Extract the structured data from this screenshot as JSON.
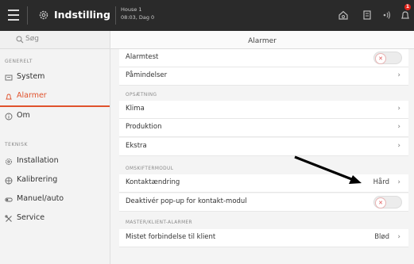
{
  "topbar": {
    "title": "Indstilling",
    "house_line1": "House 1",
    "house_line2": "08:03, Dag 0",
    "badge": "1"
  },
  "sidebar": {
    "search_placeholder": "Søg",
    "section_general": "GENERELT",
    "section_technical": "TEKNISK",
    "items": [
      {
        "label": "System",
        "icon": "system-icon"
      },
      {
        "label": "Alarmer",
        "icon": "bell-icon",
        "active": true
      },
      {
        "label": "Om",
        "icon": "info-icon"
      },
      {
        "label": "Installation",
        "icon": "installation-icon"
      },
      {
        "label": "Kalibrering",
        "icon": "calibration-icon"
      },
      {
        "label": "Manuel/auto",
        "icon": "manual-auto-icon"
      },
      {
        "label": "Service",
        "icon": "service-icon"
      }
    ]
  },
  "main": {
    "title": "Alarmer",
    "rows": {
      "alarmtest": "Alarmtest",
      "paamindelser": "Påmindelser",
      "klima": "Klima",
      "produktion": "Produktion",
      "ekstra": "Ekstra",
      "kontaktaendring": "Kontaktændring",
      "kontaktaendring_value": "Hård",
      "deaktiver": "Deaktivér pop-up for kontakt-modul",
      "mistet": "Mistet forbindelse til klient",
      "mistet_value": "Blød"
    },
    "groups": {
      "opsaetning": "OPSÆTNING",
      "omskiftermodul": "OMSKIFTERMODUL",
      "master": "MASTER/KLIENT-ALARMER"
    },
    "toggles": {
      "alarmtest": false,
      "deaktiver": false
    }
  },
  "colors": {
    "accent": "#e0522c",
    "topbar": "#2a2a2a",
    "badge": "#e2231a"
  }
}
